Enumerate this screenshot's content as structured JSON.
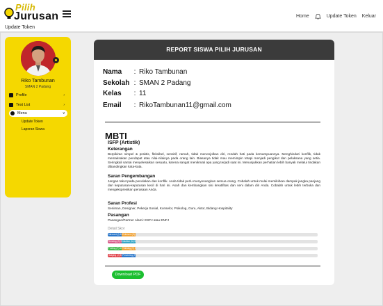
{
  "logo": {
    "top": "Pilih",
    "bottom": "Jurusan"
  },
  "breadcrumb": "Update Token",
  "nav": {
    "home": "Home",
    "update_token": "Update Token",
    "logout": "Keluar"
  },
  "sidebar": {
    "name": "Riko Tambunan",
    "school": "SMAN 2 Padang",
    "items": [
      {
        "label": "Profile",
        "chevron": "›"
      },
      {
        "label": "Test List",
        "chevron": "›"
      },
      {
        "label": "Menu",
        "chevron": "v"
      }
    ],
    "subitems": [
      "Update Token",
      "Laporan Siswa"
    ]
  },
  "report": {
    "header": "REPORT SISWA PILIH JURUSAN",
    "colon": ":",
    "fields": [
      {
        "label": "Nama",
        "value": "Riko Tambunan"
      },
      {
        "label": "Sekolah",
        "value": "SMAN 2 Padang"
      },
      {
        "label": "Kelas",
        "value": "11"
      },
      {
        "label": "Email",
        "value": "RikoTambunan11@gmail.com"
      }
    ],
    "mbti_title": "MBTI",
    "type": "ISFP (Artistik)",
    "sections": {
      "keterangan_title": "Keterangan",
      "keterangan": "Berpikiran simpel & praktis, fleksibel, sensitif, ramah, tidak menonjolkan diri, rendah hati pada kemampuannya. Menghindari konflik, tidak memaksakan pendapat atau nilai-nilainya pada orang lain. Biasanya tidak mau memimpin tetapi menjadi pengikut dan pelaksana yang setia. Seringkali santai menyelesaikan sesuatu, karena sangat menikmati apa yang terjadi saat ini. Menunjukkan perhatian lebih banyak melalui tindakan dibandingkan kata-kata.",
      "saran_title": "Saran Pengembangan",
      "saran": "Jangan takut pada penolakan dan konflik. Anda tidak perlu menyenangkan semua orang. Cobalah untuk mulai memikirkan dampak jangka panjang dari keputusan-keputusan kecil di hari ini. Asah dan kembangkan sisi kreatifitas dan seni dalam diri Anda. Cobalah untuk lebih terbuka dan mengekspresikan perasaan Anda.",
      "profesi_title": "Saran Profesi",
      "profesi": "Seniman, Designer, Pekerja Sosial, Konselor, Psikolog, Guru, Aktor, Bidang Hospitality",
      "pasangan_title": "Pasangan",
      "pasangan": "Pasangan/Partner Alami: ESFJ atau ENFJ"
    },
    "skor_label": "Detail Skor",
    "scores": [
      {
        "a": "Introvert (I) 50%",
        "b": "Extrovert (E) 50%",
        "ca": "#2a76c9",
        "cb": "#f0a43a"
      },
      {
        "a": "Sensing (S) 50%",
        "b": "Intuition (N) 50%",
        "ca": "#d85c8a",
        "cb": "#37a6c7"
      },
      {
        "a": "Feeling (F) 50%",
        "b": "Thinking (T) 50%",
        "ca": "#3fb84a",
        "cb": "#f0a43a"
      },
      {
        "a": "Judging (J) 50%",
        "b": "Perceiving (P) 50%",
        "ca": "#e0444c",
        "cb": "#2a76c9"
      }
    ],
    "download": "Download PDF"
  }
}
